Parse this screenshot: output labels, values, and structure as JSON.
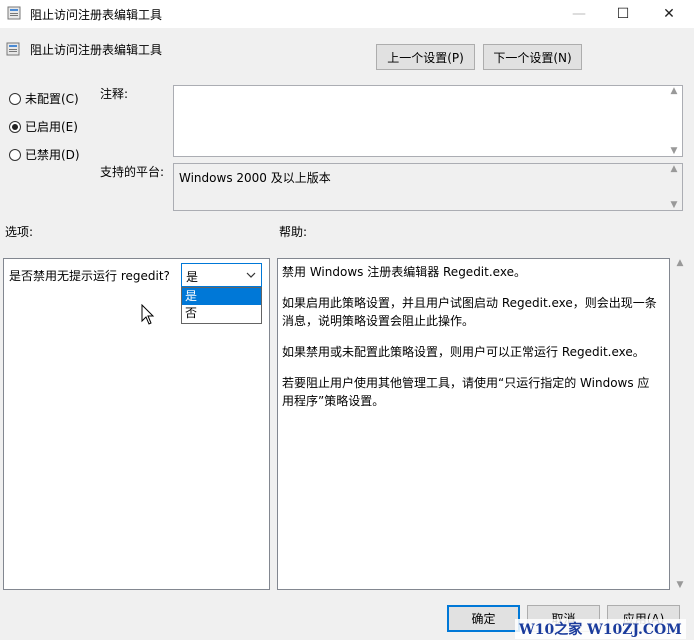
{
  "window": {
    "title": "阻止访问注册表编辑工具",
    "controls": {
      "minimize": "—",
      "maximize": "☐",
      "close": "✕"
    }
  },
  "header": {
    "policy_name": "阻止访问注册表编辑工具",
    "prev_button": "上一个设置(P)",
    "next_button": "下一个设置(N)"
  },
  "state": {
    "options": [
      {
        "label": "未配置(C)",
        "checked": false
      },
      {
        "label": "已启用(E)",
        "checked": true
      },
      {
        "label": "已禁用(D)",
        "checked": false
      }
    ]
  },
  "comment": {
    "label": "注释:",
    "value": ""
  },
  "platform": {
    "label": "支持的平台:",
    "value": "Windows 2000 及以上版本"
  },
  "options_section": {
    "label": "选项:",
    "question": "是否禁用无提示运行 regedit?",
    "selected": "是",
    "choices": [
      "是",
      "否"
    ]
  },
  "help_section": {
    "label": "帮助:",
    "paragraphs": [
      "禁用 Windows 注册表编辑器 Regedit.exe。",
      "如果启用此策略设置，并且用户试图启动 Regedit.exe，则会出现一条消息，说明策略设置会阻止此操作。",
      "如果禁用或未配置此策略设置，则用户可以正常运行 Regedit.exe。",
      "若要阻止用户使用其他管理工具，请使用“只运行指定的 Windows 应用程序”策略设置。"
    ]
  },
  "footer": {
    "ok": "确定",
    "cancel": "取消",
    "apply": "应用(A)"
  },
  "watermark": "W10之家 W10ZJ.COM",
  "colors": {
    "accent": "#0078d7",
    "watermark": "#1a3b9c"
  }
}
